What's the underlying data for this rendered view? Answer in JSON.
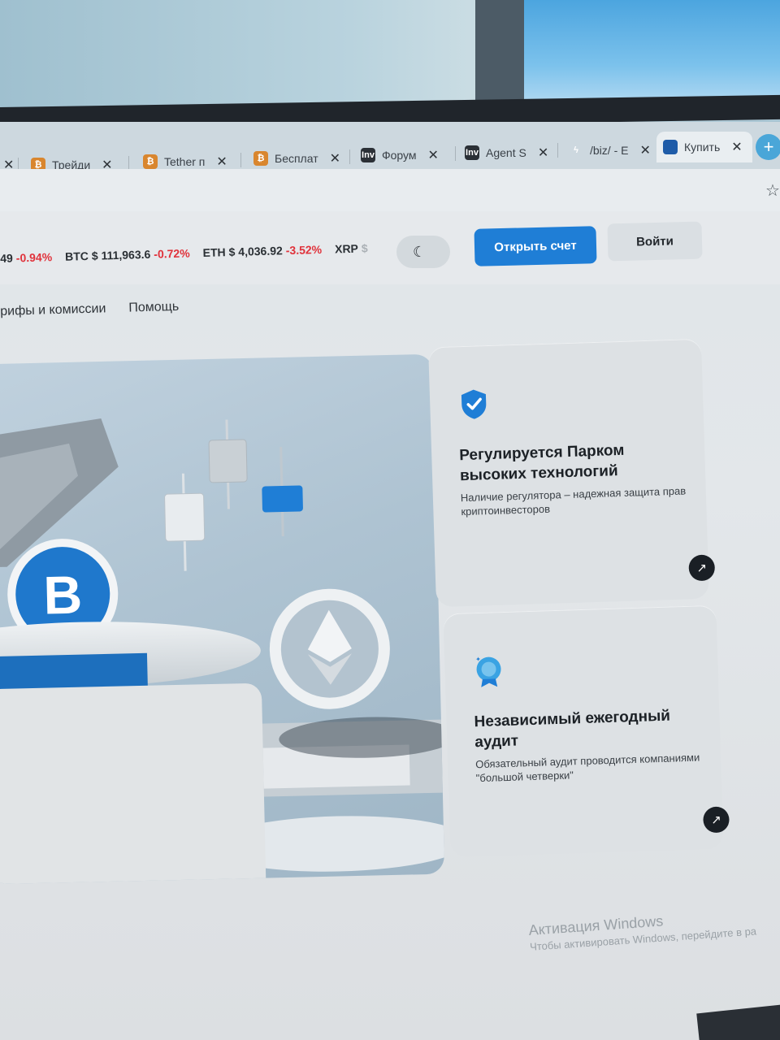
{
  "browser": {
    "tabs": [
      {
        "label": "",
        "favicon": "close-x",
        "active": false
      },
      {
        "label": "Трейди",
        "favicon": "shield-bitcoin-icon",
        "active": false
      },
      {
        "label": "Tether п",
        "favicon": "shield-bitcoin-icon",
        "active": false
      },
      {
        "label": "Бесплат",
        "favicon": "shield-bitcoin-icon",
        "active": false
      },
      {
        "label": "Форум",
        "favicon": "inv-icon",
        "active": false
      },
      {
        "label": "Agent S",
        "favicon": "inv-icon",
        "active": false
      },
      {
        "label": "/biz/ - E",
        "favicon": "fire-icon",
        "active": false
      },
      {
        "label": "Купить",
        "favicon": "blue-square-icon",
        "active": true
      }
    ],
    "new_tab_symbol": "+",
    "close_symbol": "✕",
    "bookmark_symbol": "☆"
  },
  "header": {
    "ticker": [
      {
        "symbol": "",
        "price": "49",
        "change": "-0.94%"
      },
      {
        "symbol": "BTC",
        "price": "$ 111,963.6",
        "change": "-0.72%"
      },
      {
        "symbol": "ETH",
        "price": "$ 4,036.92",
        "change": "-3.52%"
      },
      {
        "symbol": "XRP",
        "price": "$",
        "change": ""
      }
    ],
    "theme_toggle_symbol": "☾",
    "open_account_label": "Открыть счет",
    "login_label": "Войти"
  },
  "nav": {
    "items": [
      "рифы и комиссии",
      "Помощь"
    ]
  },
  "hero": {
    "bitcoin_symbol": "B"
  },
  "cards": [
    {
      "title": "Регулируется Парком высоких технологий",
      "text": "Наличие регулятора – надежная защита прав криптоинвесторов",
      "icon": "shield-check-icon",
      "arrow": "↗"
    },
    {
      "title": "Независимый ежегодный аудит",
      "text": "Обязательный аудит проводится компаниями \"большой четверки\"",
      "icon": "award-badge-icon",
      "arrow": "↗"
    }
  ],
  "watermark": {
    "title": "Активация Windows",
    "subtitle": "Чтобы активировать Windows, перейдите в ра"
  },
  "colors": {
    "accent": "#1f7ed6",
    "negative": "#e0323b",
    "dark_button": "#1a1f25"
  }
}
